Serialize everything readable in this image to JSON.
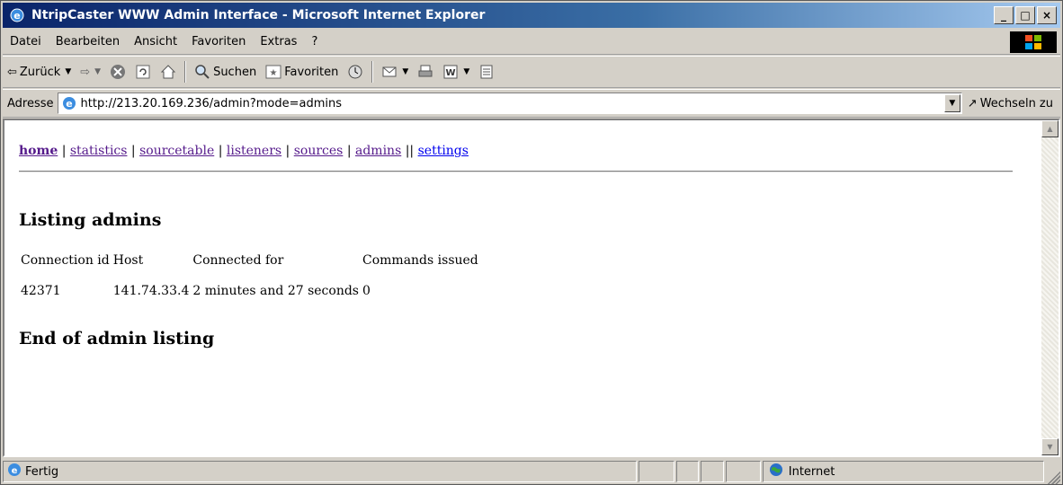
{
  "window": {
    "title": "NtripCaster WWW Admin Interface - Microsoft Internet Explorer",
    "controls": [
      "_",
      "□",
      "×"
    ]
  },
  "menu": [
    "Datei",
    "Bearbeiten",
    "Ansicht",
    "Favoriten",
    "Extras",
    "?"
  ],
  "toolbar": {
    "back_label": "Zurück",
    "search_label": "Suchen",
    "favorites_label": "Favoriten"
  },
  "address": {
    "label": "Adresse",
    "url": "http://213.20.169.236/admin?mode=admins",
    "go_label": "Wechseln zu"
  },
  "page": {
    "nav": [
      {
        "label": "home",
        "bold": true
      },
      {
        "label": "statistics"
      },
      {
        "label": "sourcetable"
      },
      {
        "label": "listeners"
      },
      {
        "label": "sources"
      },
      {
        "label": "admins"
      },
      {
        "label": "settings",
        "unvisited": true
      }
    ],
    "heading": "Listing admins",
    "table": {
      "headers": [
        "Connection id",
        "Host",
        "Connected for",
        "Commands issued"
      ],
      "rows": [
        [
          "42371",
          "141.74.33.4",
          "2 minutes and 27 seconds",
          "0"
        ]
      ]
    },
    "footer_heading": "End of admin listing"
  },
  "status": {
    "text": "Fertig",
    "zone": "Internet"
  },
  "colors": {
    "titlebar_start": "#0a246a",
    "titlebar_end": "#a6caf0",
    "chrome": "#d4d0c8",
    "link_visited": "#551a8b",
    "link_unvisited": "#0000ee"
  }
}
